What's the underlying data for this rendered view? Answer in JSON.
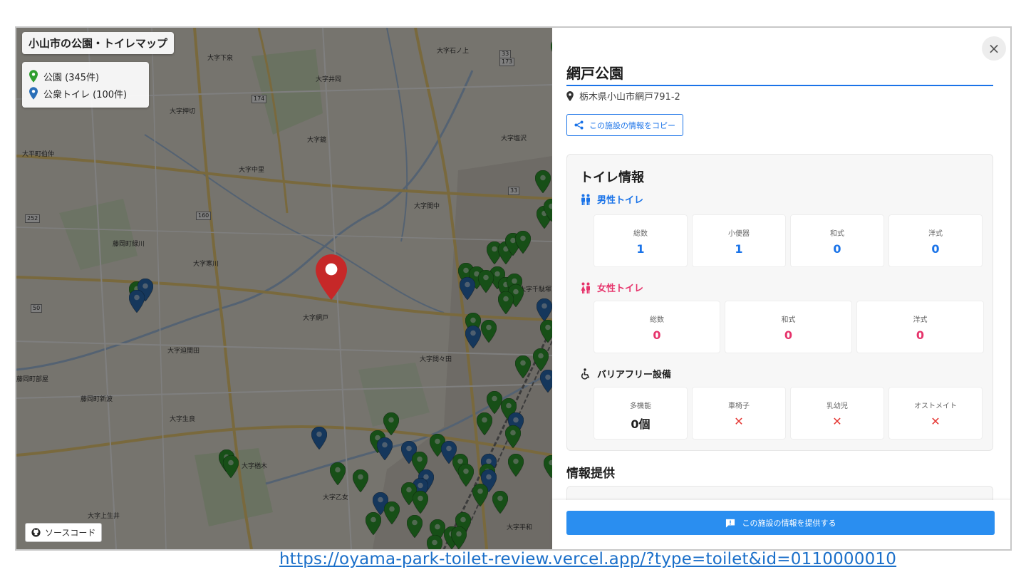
{
  "map": {
    "title": "小山市の公園・トイレマップ",
    "legend": [
      {
        "label": "公園 (345件)",
        "color": "#2e9e2e"
      },
      {
        "label": "公衆トイレ (100件)",
        "color": "#2a6fb8"
      }
    ],
    "source_button": "ソースコード",
    "place_labels": [
      "大字下泉",
      "大字井岡",
      "大字石ノ上",
      "大字押切",
      "大字鏡",
      "大字塩沢",
      "大平町伯仲",
      "大字中里",
      "大字間中",
      "藤岡町緑川",
      "大字寒川",
      "大字網戸",
      "大字迫間田",
      "大字間々田",
      "藤岡町部屋",
      "藤岡町新波",
      "大字生良",
      "大字楢木",
      "大字乙女",
      "大字上生井",
      "大字千駄塚",
      "大字平和"
    ],
    "road_numbers": [
      "33",
      "173",
      "174",
      "160",
      "252",
      "50",
      "33"
    ]
  },
  "panel": {
    "facility_name": "網戸公園",
    "address": "栃木県小山市網戸791-2",
    "copy_button": "この施設の情報をコピー",
    "toilet_info_title": "トイレ情報",
    "male": {
      "title": "男性トイレ",
      "cells": [
        {
          "label": "総数",
          "value": "1"
        },
        {
          "label": "小便器",
          "value": "1"
        },
        {
          "label": "和式",
          "value": "0"
        },
        {
          "label": "洋式",
          "value": "0"
        }
      ]
    },
    "female": {
      "title": "女性トイレ",
      "cells": [
        {
          "label": "総数",
          "value": "0"
        },
        {
          "label": "和式",
          "value": "0"
        },
        {
          "label": "洋式",
          "value": "0"
        }
      ]
    },
    "barrier_free": {
      "title": "バリアフリー設備",
      "cells": [
        {
          "label": "多機能",
          "value": "0個"
        },
        {
          "label": "車椅子",
          "value": "✕"
        },
        {
          "label": "乳幼児",
          "value": "✕"
        },
        {
          "label": "オストメイト",
          "value": "✕"
        }
      ]
    },
    "info_heading": "情報提供",
    "provide_button": "この施設の情報を提供する",
    "close": "×"
  },
  "url": "https://oyama-park-toilet-review.vercel.app/?type=toilet&id=0110000010",
  "colors": {
    "accent": "#1a73e8",
    "male": "#1a73e8",
    "female": "#e6336b",
    "park_pin": "#2e9e2e",
    "toilet_pin": "#2a6fb8",
    "selected_pin": "#c62828",
    "cross": "#e53935"
  }
}
